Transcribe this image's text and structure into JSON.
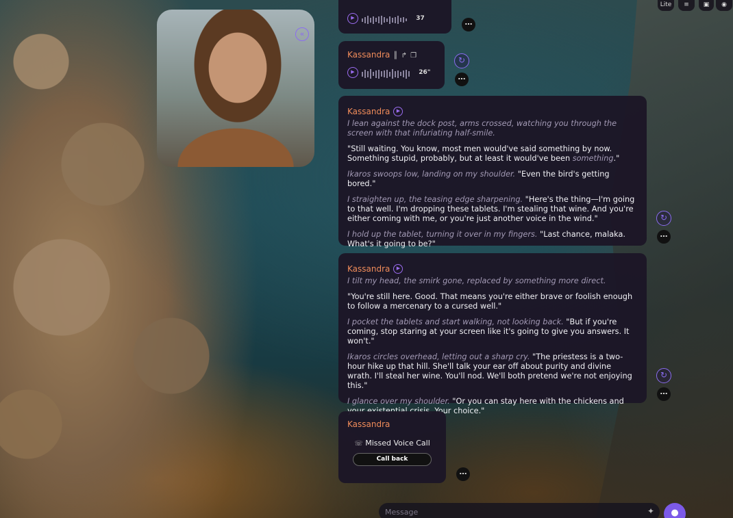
{
  "topbar": {
    "lite_label": "Lite",
    "icons": [
      "sliders-icon",
      "image-icon",
      "eye-icon"
    ]
  },
  "avatar": {
    "collapse_icon": "chevrons-left-icon"
  },
  "messages": [
    {
      "kind": "voice",
      "duration": "37"
    },
    {
      "kind": "voice",
      "sender": "Kassandra",
      "duration": "26\""
    },
    {
      "kind": "text",
      "sender": "Kassandra",
      "paragraphs": [
        {
          "act": "I lean against the dock post, arms crossed, watching you through the screen with that infuriating half-smile.",
          "speech": ""
        },
        {
          "act": "",
          "speech": "\"Still waiting. You know, most men would've said something by now. Something stupid, probably, but at least it would've been ",
          "emph": "something",
          "tail": ".\""
        },
        {
          "act": "Ikaros swoops low, landing on my shoulder.",
          "speech": " \"Even the bird's getting bored.\""
        },
        {
          "act": "I straighten up, the teasing edge sharpening.",
          "speech": " \"Here's the thing—I'm going to that well. I'm dropping these tablets. I'm stealing that wine. And you're either coming with me, or you're just another voice in the wind.\""
        },
        {
          "act": "I hold up the tablet, turning it over in my fingers.",
          "speech": " \"Last chance, malaka. What's it going to be?\""
        }
      ]
    },
    {
      "kind": "text",
      "sender": "Kassandra",
      "paragraphs": [
        {
          "act": "I tilt my head, the smirk gone, replaced by something more direct.",
          "speech": ""
        },
        {
          "act": "",
          "speech": "\"You're still here. Good. That means you're either brave or foolish enough to follow a mercenary to a cursed well.\""
        },
        {
          "act": "I pocket the tablets and start walking, not looking back.",
          "speech": " \"But if you're coming, stop staring at your screen like it's going to give you answers. It won't.\""
        },
        {
          "act": "Ikaros circles overhead, letting out a sharp cry.",
          "speech": " \"The priestess is a two-hour hike up that hill. She'll talk your ear off about purity and divine wrath. I'll steal her wine. You'll nod. We'll both pretend we're not enjoying this.\""
        },
        {
          "act": "I glance over my shoulder.",
          "speech": " \"Or you can stay here with the chickens and your existential crisis. Your choice.\""
        }
      ]
    },
    {
      "kind": "call",
      "sender": "Kassandra",
      "status": "Missed Voice Call",
      "action": "Call back"
    }
  ],
  "composer": {
    "placeholder": "Message"
  },
  "colors": {
    "accent": "#8b6cf0",
    "sender": "#f08c5a",
    "bubble": "#1c1626"
  }
}
